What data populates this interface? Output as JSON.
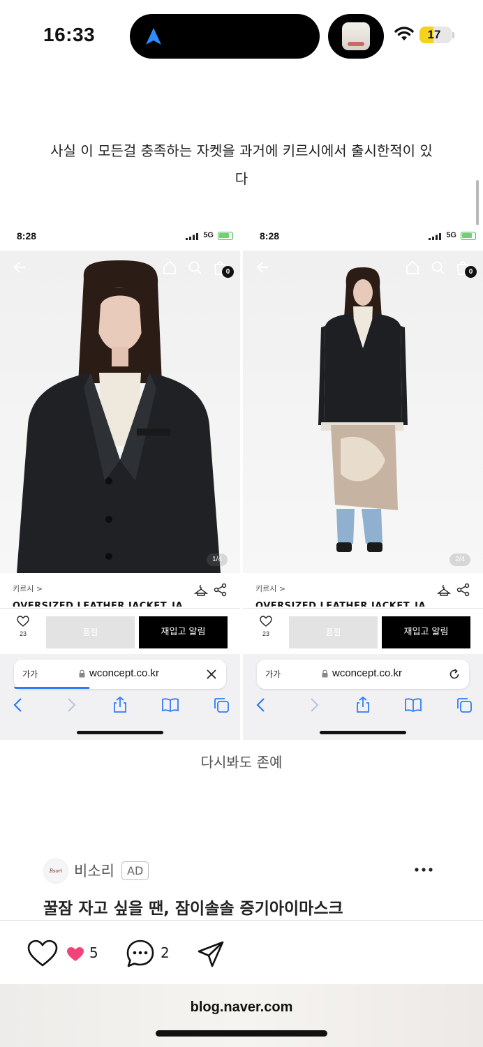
{
  "status_bar": {
    "time": "16:33",
    "battery_level": "17",
    "battery_fraction": 0.17,
    "accent_color": "#f6d21b"
  },
  "post": {
    "paragraph_line1": "사실 이 모든걸 충족하는 자켓을 과거에 키르시에서 출시한적이 있",
    "paragraph_line2": "다",
    "caption": "다시봐도 존예"
  },
  "screenshots": [
    {
      "time": "8:28",
      "network": "5G",
      "cart_count": "0",
      "pager": "1/4",
      "brand": "키르시 >",
      "product_name": "OVERSIZED LEATHER JACKET_JA",
      "like_count": "23",
      "soldout_label": "품절",
      "restock_label": "재입고 알림",
      "text_size_label": "가가",
      "domain": "wconcept.co.kr",
      "url_action_icon": "close-icon"
    },
    {
      "time": "8:28",
      "network": "5G",
      "cart_count": "0",
      "pager": "2/4",
      "brand": "키르시 >",
      "product_name": "OVERSIZED LEATHER JACKET_JA",
      "like_count": "23",
      "soldout_label": "품절",
      "restock_label": "재입고 알림",
      "text_size_label": "가가",
      "domain": "wconcept.co.kr",
      "url_action_icon": "reload-icon"
    }
  ],
  "ad": {
    "logo_text": "Bsori",
    "advertiser": "비소리",
    "badge": "AD",
    "title": "꿀잠 자고 싶을 땐, 잠이솔솔 증기아이마스크"
  },
  "actions": {
    "likes": "5",
    "comments": "2",
    "like_color": "#f0437a"
  },
  "browser": {
    "host": "blog.naver.com"
  }
}
